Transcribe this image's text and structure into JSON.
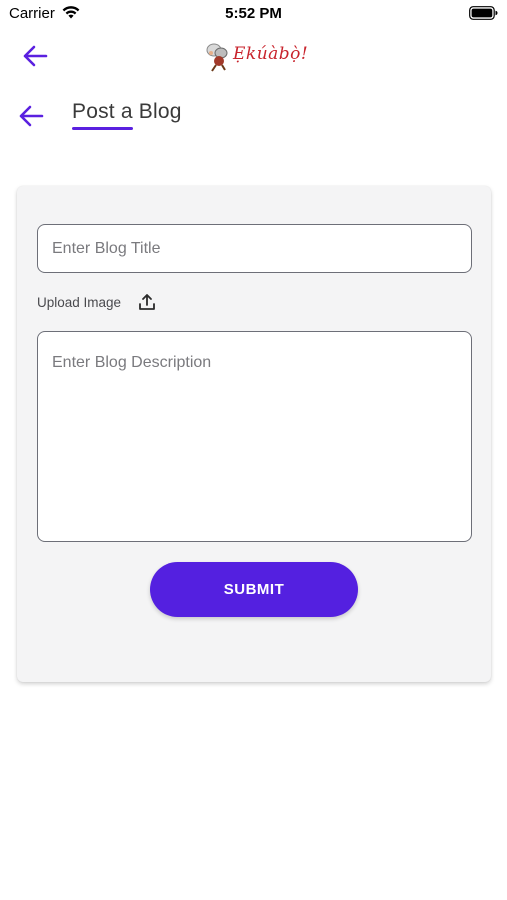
{
  "status_bar": {
    "carrier": "Carrier",
    "time": "5:52 PM"
  },
  "header": {
    "logo_text": "Ẹkúàbọ̀!",
    "back_icon": "arrow-left-icon"
  },
  "page": {
    "title": "Post a Blog"
  },
  "form": {
    "title_placeholder": "Enter Blog Title",
    "title_value": "",
    "upload_label": "Upload Image",
    "upload_icon": "upload-icon",
    "description_placeholder": "Enter Blog Description",
    "description_value": "",
    "submit_label": "SUBMIT"
  },
  "colors": {
    "accent": "#5420e0",
    "logo_red": "#c8232c",
    "card_background": "#f4f4f5"
  }
}
